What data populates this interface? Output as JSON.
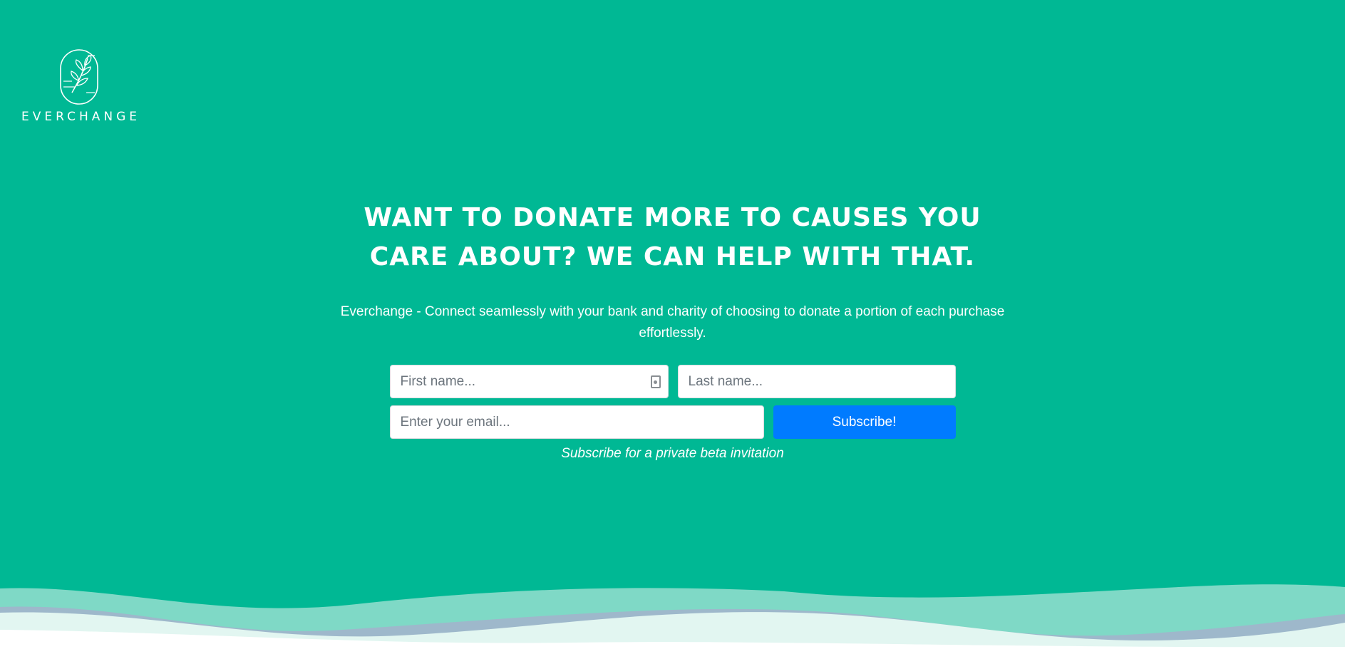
{
  "brand": {
    "logo_icon": "leaf-branch-icon",
    "name": "EVERCHANGE"
  },
  "hero": {
    "headline": "WANT TO DONATE MORE TO CAUSES YOU CARE ABOUT? WE CAN HELP WITH THAT.",
    "subtitle": "Everchange - Connect seamlessly with your bank and charity of choosing to donate a portion of each purchase effortlessly."
  },
  "form": {
    "first_name_placeholder": "First name...",
    "last_name_placeholder": "Last name...",
    "email_placeholder": "Enter your email...",
    "autofill_icon": "contact-card-icon",
    "subscribe_label": "Subscribe!",
    "note": "Subscribe for a private beta invitation"
  },
  "colors": {
    "background": "#00b894",
    "button": "#007bff",
    "text": "#ffffff"
  }
}
